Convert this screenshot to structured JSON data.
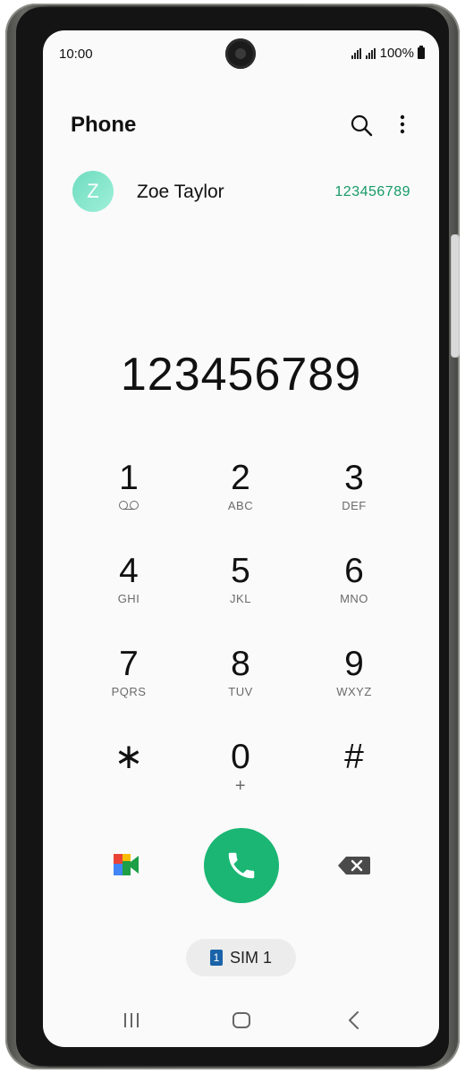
{
  "status_bar": {
    "time": "10:00",
    "battery": "100%"
  },
  "header": {
    "title": "Phone",
    "search_icon": "search-icon",
    "more_icon": "more-vertical-icon"
  },
  "suggestion": {
    "avatar_letter": "Z",
    "name": "Zoe Taylor",
    "number": "123456789"
  },
  "dialer": {
    "entered_number": "123456789",
    "keys": [
      {
        "digit": "1",
        "letters": ""
      },
      {
        "digit": "2",
        "letters": "ABC"
      },
      {
        "digit": "3",
        "letters": "DEF"
      },
      {
        "digit": "4",
        "letters": "GHI"
      },
      {
        "digit": "5",
        "letters": "JKL"
      },
      {
        "digit": "6",
        "letters": "MNO"
      },
      {
        "digit": "7",
        "letters": "PQRS"
      },
      {
        "digit": "8",
        "letters": "TUV"
      },
      {
        "digit": "9",
        "letters": "WXYZ"
      },
      {
        "digit": "∗",
        "letters": ""
      },
      {
        "digit": "0",
        "letters": "+"
      },
      {
        "digit": "#",
        "letters": ""
      }
    ]
  },
  "actions": {
    "sim_label": "SIM 1",
    "sim_number": "1"
  },
  "colors": {
    "call_green": "#1bb673",
    "number_green": "#159a67",
    "sim_blue": "#1a63a8"
  }
}
